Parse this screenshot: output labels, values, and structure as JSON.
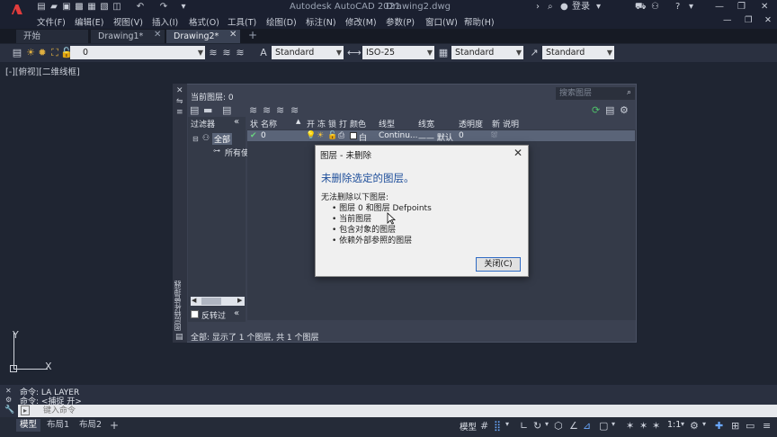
{
  "app": {
    "title": "Autodesk AutoCAD 2021",
    "document": "Drawing2.dwg",
    "logo": "A"
  },
  "user": {
    "login": "登录"
  },
  "menu": [
    "文件(F)",
    "编辑(E)",
    "视图(V)",
    "插入(I)",
    "格式(O)",
    "工具(T)",
    "绘图(D)",
    "标注(N)",
    "修改(M)",
    "参数(P)",
    "窗口(W)",
    "帮助(H)"
  ],
  "tabs": [
    {
      "label": "开始"
    },
    {
      "label": "Drawing1*"
    },
    {
      "label": "Drawing2*"
    }
  ],
  "toolbar": {
    "layer_value": "0",
    "text_style": "Standard",
    "dim_style": "ISO-25",
    "table_style": "Standard",
    "mleader_style": "Standard"
  },
  "viewport_label": "[-][俯视][二维线框]",
  "layer_manager": {
    "current_layer": "当前图层: 0",
    "search_placeholder": "搜索图层",
    "filters_header": "过滤器",
    "filter_all": "全部",
    "filter_used": "所有使",
    "invert_filter": "反转过",
    "vertical_title": "图层特性管理器",
    "columns": [
      "状",
      "名称",
      "开",
      "冻",
      "锁",
      "打",
      "颜色",
      "线型",
      "线宽",
      "透明度",
      "新",
      "说明"
    ],
    "row": {
      "name": "0",
      "color": "白",
      "linetype": "Continu...",
      "lineweight": "—— 默认",
      "transparency": "0"
    },
    "status": "全部: 显示了 1 个图层, 共 1 个图层"
  },
  "dialog": {
    "title": "图层 - 未删除",
    "heading": "未删除选定的图层。",
    "intro": "无法删除以下图层:",
    "bullets": [
      "图层 0 和图层 Defpoints",
      "当前图层",
      "包含对象的图层",
      "依赖外部参照的图层"
    ],
    "close_label": "关闭(C)"
  },
  "command": {
    "history": [
      "命令:  LA  LAYER",
      "命令:  <捕捉 开>"
    ],
    "placeholder": "键入命令"
  },
  "status": {
    "layout_tabs": [
      "模型",
      "布局1",
      "布局2"
    ],
    "model_label": "模型",
    "scale": "1:1"
  },
  "ucs": {
    "x": "X",
    "y": "Y"
  },
  "colors": {
    "accent": "#2f6bc4",
    "heading": "#1e4e9a",
    "logo": "#e23c3c"
  }
}
